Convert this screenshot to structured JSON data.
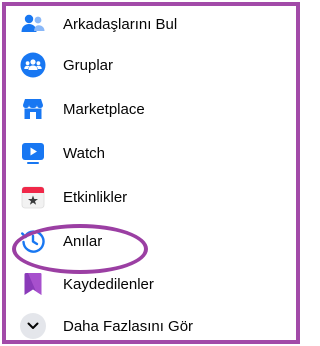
{
  "menu": {
    "items": [
      {
        "label": "Arkadaşlarını Bul",
        "icon": "friends-icon"
      },
      {
        "label": "Gruplar",
        "icon": "groups-icon"
      },
      {
        "label": "Marketplace",
        "icon": "marketplace-icon"
      },
      {
        "label": "Watch",
        "icon": "watch-icon"
      },
      {
        "label": "Etkinlikler",
        "icon": "events-icon"
      },
      {
        "label": "Anılar",
        "icon": "memories-icon"
      },
      {
        "label": "Kaydedilenler",
        "icon": "saved-icon"
      },
      {
        "label": "Daha Fazlasını Gör",
        "icon": "chevron-down-icon"
      }
    ]
  },
  "colors": {
    "frame": "#a24aa8",
    "highlight": "#9b3fa3",
    "facebook_blue": "#1877f2"
  }
}
